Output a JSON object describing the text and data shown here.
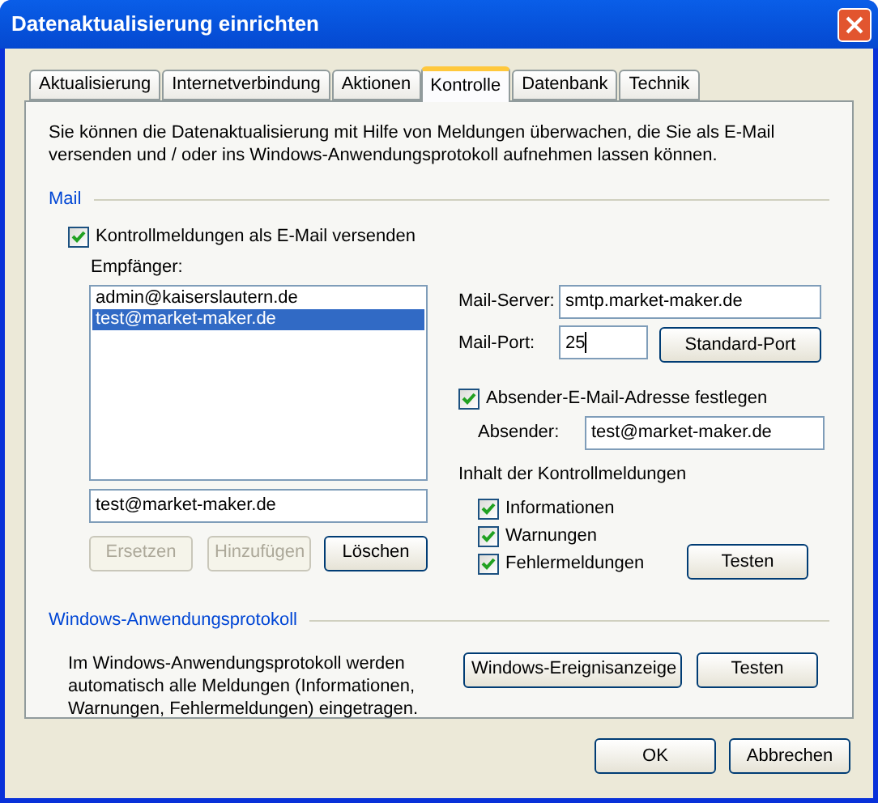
{
  "window": {
    "title": "Datenaktualisierung einrichten"
  },
  "tabs": [
    {
      "label": "Aktualisierung",
      "selected": false
    },
    {
      "label": "Internetverbindung",
      "selected": false
    },
    {
      "label": "Aktionen",
      "selected": false
    },
    {
      "label": "Kontrolle",
      "selected": true
    },
    {
      "label": "Datenbank",
      "selected": false
    },
    {
      "label": "Technik",
      "selected": false
    }
  ],
  "intro": "Sie können die Datenaktualisierung mit Hilfe von Meldungen überwachen, die Sie als E-Mail versenden und / oder ins Windows-Anwendungsprotokoll aufnehmen lassen können.",
  "mail": {
    "heading": "Mail",
    "send_checkbox": {
      "label": "Kontrollmeldungen als E-Mail versenden",
      "checked": true
    },
    "recipients_label": "Empfänger:",
    "recipients": [
      {
        "address": "admin@kaiserslautern.de",
        "selected": false
      },
      {
        "address": "test@market-maker.de",
        "selected": true
      }
    ],
    "recipient_input": "test@market-maker.de",
    "recipient_buttons": [
      {
        "label": "Ersetzen",
        "disabled": true
      },
      {
        "label": "Hinzufügen",
        "disabled": true
      },
      {
        "label": "Löschen",
        "disabled": false
      }
    ],
    "server_label": "Mail-Server:",
    "server": "smtp.market-maker.de",
    "port_label": "Mail-Port:",
    "port": "25",
    "standard_port_button": "Standard-Port",
    "sender_checkbox": {
      "label": "Absender-E-Mail-Adresse festlegen",
      "checked": true
    },
    "sender_label": "Absender:",
    "sender": "test@market-maker.de",
    "content_heading": "Inhalt der Kontrollmeldungen",
    "content_options": [
      {
        "label": "Informationen",
        "checked": true
      },
      {
        "label": "Warnungen",
        "checked": true
      },
      {
        "label": "Fehlermeldungen",
        "checked": true
      }
    ],
    "test_button": "Testen"
  },
  "event_log": {
    "heading": "Windows-Anwendungsprotokoll",
    "description": "Im Windows-Anwendungsprotokoll werden automatisch alle Meldungen (Informationen, Warnungen, Fehlermeldungen) eingetragen.",
    "buttons": [
      "Windows-Ereignisanzeige",
      "Testen"
    ]
  },
  "buttons": [
    "OK",
    "Abbrechen"
  ]
}
